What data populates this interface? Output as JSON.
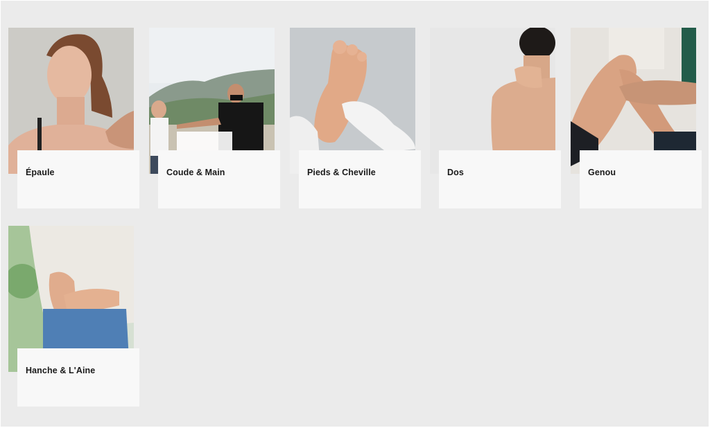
{
  "categories": [
    {
      "label": "Épaule",
      "image": "woman-shoulder-massage-photo"
    },
    {
      "label": "Coude & Main",
      "image": "elbow-stretch-outdoor-photo"
    },
    {
      "label": "Pieds & Cheville",
      "image": "foot-massage-gloves-photo"
    },
    {
      "label": "Dos",
      "image": "bare-back-neck-photo"
    },
    {
      "label": "Genou",
      "image": "knee-therapy-photo"
    },
    {
      "label": "Hanche & L'Aine",
      "image": "hip-hands-jeans-photo"
    }
  ]
}
